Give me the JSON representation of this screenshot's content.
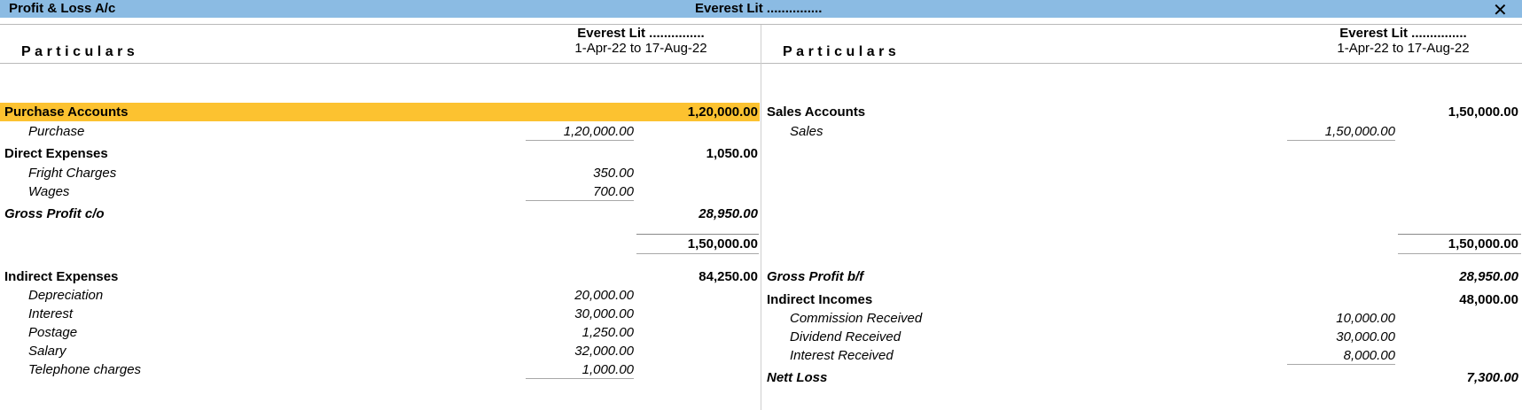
{
  "window": {
    "title": "Profit & Loss A/c",
    "company_center": "Everest Lit ...............",
    "close_glyph": "✕"
  },
  "header": {
    "particulars": "Particulars",
    "left_company": "Everest Lit ...............",
    "left_period": "1-Apr-22 to 17-Aug-22",
    "right_company": "Everest Lit ...............",
    "right_period": "1-Apr-22 to 17-Aug-22"
  },
  "left": {
    "purchase_accounts": {
      "label": "Purchase Accounts",
      "total": "1,20,000.00"
    },
    "purchase": {
      "label": "Purchase",
      "amount": "1,20,000.00"
    },
    "direct_expenses": {
      "label": "Direct Expenses",
      "total": "1,050.00"
    },
    "fright_charges": {
      "label": "Fright Charges",
      "amount": "350.00"
    },
    "wages": {
      "label": "Wages",
      "amount": "700.00"
    },
    "gross_profit_co": {
      "label": "Gross Profit c/o",
      "total": "28,950.00"
    },
    "subtotal": "1,50,000.00",
    "indirect_expenses": {
      "label": "Indirect Expenses",
      "total": "84,250.00"
    },
    "items": [
      {
        "label": "Depreciation",
        "amount": "20,000.00"
      },
      {
        "label": "Interest",
        "amount": "30,000.00"
      },
      {
        "label": "Postage",
        "amount": "1,250.00"
      },
      {
        "label": "Salary",
        "amount": "32,000.00"
      },
      {
        "label": "Telephone charges",
        "amount": "1,000.00"
      }
    ]
  },
  "right": {
    "sales_accounts": {
      "label": "Sales Accounts",
      "total": "1,50,000.00"
    },
    "sales": {
      "label": "Sales",
      "amount": "1,50,000.00"
    },
    "subtotal": "1,50,000.00",
    "gross_profit_bf": {
      "label": "Gross Profit b/f",
      "total": "28,950.00"
    },
    "indirect_incomes": {
      "label": "Indirect Incomes",
      "total": "48,000.00"
    },
    "items": [
      {
        "label": "Commission Received",
        "amount": "10,000.00"
      },
      {
        "label": "Dividend Received",
        "amount": "30,000.00"
      },
      {
        "label": "Interest Received",
        "amount": "8,000.00"
      }
    ],
    "nett_loss": {
      "label": "Nett Loss",
      "total": "7,300.00"
    }
  },
  "colors": {
    "titlebar": "#8bbbe3",
    "highlight": "#fcc230"
  }
}
